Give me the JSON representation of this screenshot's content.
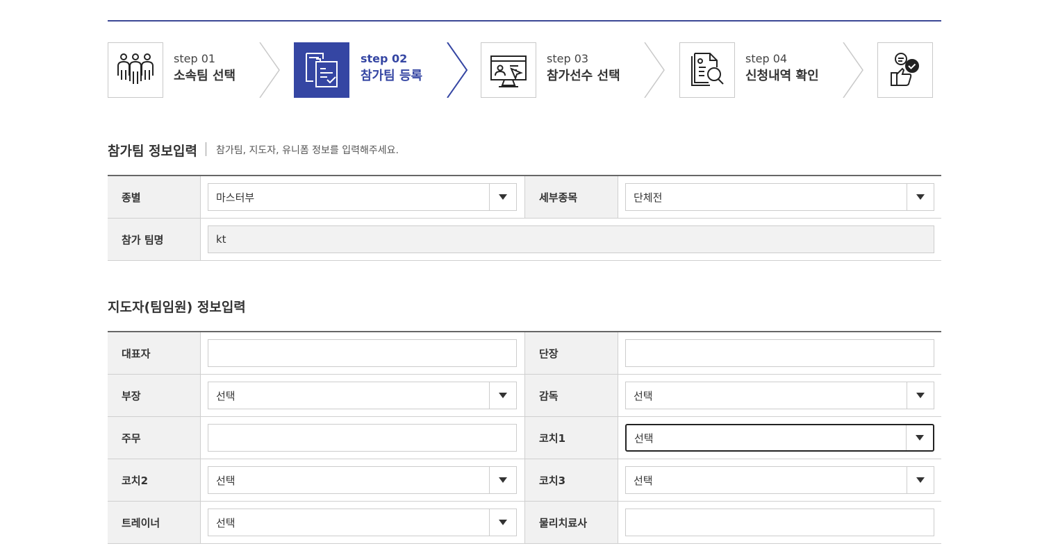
{
  "steps": [
    {
      "num": "step 01",
      "title": "소속팀 선택",
      "icon": "team-people-icon",
      "active": false
    },
    {
      "num": "step 02",
      "title": "참가팀 등록",
      "icon": "document-register-icon",
      "active": true
    },
    {
      "num": "step 03",
      "title": "참가선수 선택",
      "icon": "player-select-monitor-icon",
      "active": false
    },
    {
      "num": "step 04",
      "title": "신청내역 확인",
      "icon": "document-search-icon",
      "active": false
    },
    {
      "icon": "thumbs-up-check-icon",
      "active": false
    }
  ],
  "colors": {
    "accent": "#3546a3",
    "label_bg": "#f1f1f1",
    "readonly_bg": "#f2f2f2"
  },
  "team_section": {
    "title": "참가팀 정보입력",
    "desc": "참가팀, 지도자, 유니폼 정보를 입력해주세요.",
    "division_label": "종별",
    "division_value": "마스터부",
    "event_label": "세부종목",
    "event_value": "단체전",
    "team_name_label": "참가 팀명",
    "team_name_value": "kt"
  },
  "staff_section": {
    "title": "지도자(팀임원) 정보입력",
    "rows": [
      [
        {
          "label": "대표자",
          "type": "text",
          "value": ""
        },
        {
          "label": "단장",
          "type": "text",
          "value": ""
        }
      ],
      [
        {
          "label": "부장",
          "type": "select",
          "value": "선택"
        },
        {
          "label": "감독",
          "type": "select",
          "value": "선택"
        }
      ],
      [
        {
          "label": "주무",
          "type": "text",
          "value": ""
        },
        {
          "label": "코치1",
          "type": "select",
          "value": "선택"
        }
      ],
      [
        {
          "label": "코치2",
          "type": "select",
          "value": "선택"
        },
        {
          "label": "코치3",
          "type": "select",
          "value": "선택"
        }
      ],
      [
        {
          "label": "트레이너",
          "type": "select",
          "value": "선택"
        },
        {
          "label": "물리치료사",
          "type": "text",
          "value": ""
        }
      ]
    ]
  }
}
